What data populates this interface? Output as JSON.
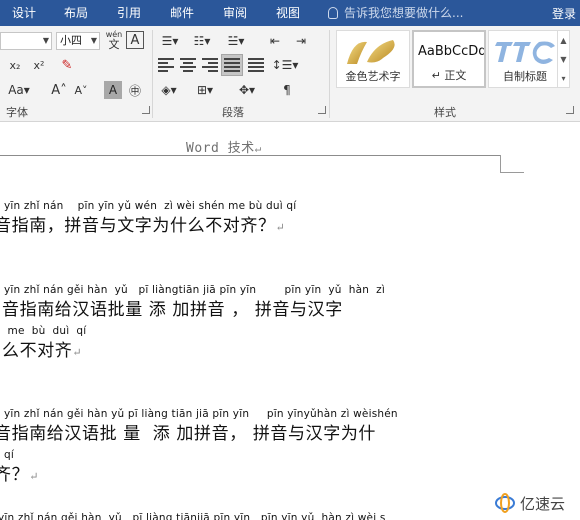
{
  "menu": {
    "tabs": [
      "设计",
      "布局",
      "引用",
      "邮件",
      "审阅",
      "视图"
    ],
    "tell_me": "告诉我您想要做什么...",
    "login": "登录"
  },
  "ribbon": {
    "font_size": "小四",
    "pinyin_guide": "wén",
    "group_font": "字体",
    "group_paragraph": "段落",
    "group_styles": "样式",
    "styles": [
      {
        "preview": "",
        "label": "金色艺术字"
      },
      {
        "preview": "AaBbCcDd",
        "label": "↵ 正文"
      },
      {
        "preview": "",
        "label": "自制标题"
      }
    ]
  },
  "document": {
    "header": "Word 技术",
    "blocks": [
      {
        "pinyin": "yīn zhǐ nán    pīn yīn yǔ wén  zì wèi shén me bù duì qí",
        "hanzi": "音指南，拼音与文字为什么不对齐？"
      },
      {
        "pinyin": "yīn zhǐ nán gěi hàn  yǔ   pī liàngtiān jiā pīn yīn        pīn yīn  yǔ  hàn  zì",
        "hanzi": "音指南给汉语批量 添 加拼音 ， 拼音与汉字"
      },
      {
        "pinyin": " me  bù  duì  qí",
        "hanzi": "么不对齐"
      },
      {
        "pinyin": "yīn zhǐ nán gěi hàn yǔ pī liàng tiān jiā pīn yīn     pīn yīnyǔhàn zì wèishén",
        "hanzi": "音指南给汉语批 量  添 加拼音， 拼音与汉字为什"
      },
      {
        "pinyin": "qí",
        "hanzi": "齐？"
      },
      {
        "pinyin": "yīn zhǐ nán gěi hàn  yǔ   pī liàng tiānjiā pīn yīn   pīn yīn yǔ  hàn zì wèi s",
        "hanzi": ""
      }
    ],
    "para_mark": "↵"
  },
  "watermark": "亿速云",
  "colors": {
    "accent": "#2b579a"
  }
}
